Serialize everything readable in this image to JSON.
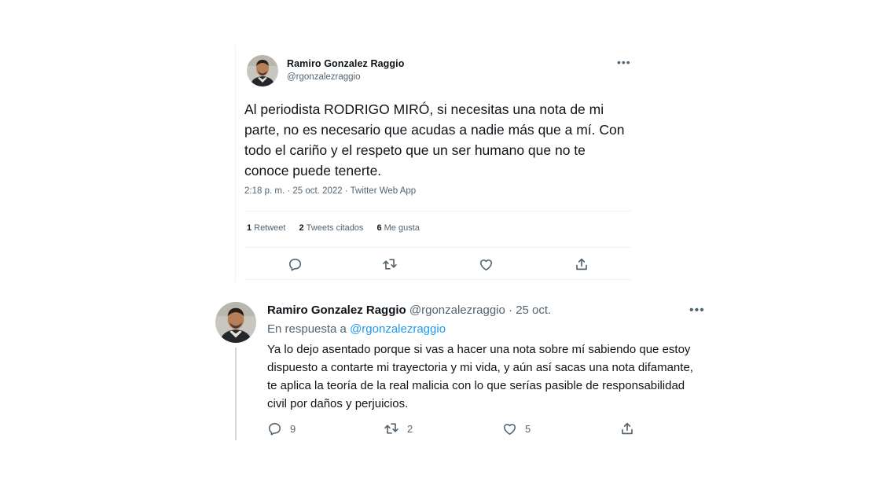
{
  "tweet1": {
    "author_name": "Ramiro Gonzalez Raggio",
    "author_handle": "@rgonzalezraggio",
    "more_icon": "more-horizontal-icon",
    "text": "Al periodista RODRIGO MIRÓ, si necesitas una nota de mi parte, no es necesario que acudas a nadie más que a mí. Con todo el cariño y el respeto que un ser humano que no te conoce puede tenerte.",
    "meta": "2:18 p. m. · 25 oct. 2022 · Twitter Web App",
    "stats": {
      "retweets_count": "1",
      "retweets_label": "Retweet",
      "quotes_count": "2",
      "quotes_label": "Tweets citados",
      "likes_count": "6",
      "likes_label": "Me gusta"
    },
    "actions": [
      "reply-icon",
      "retweet-icon",
      "like-icon",
      "share-icon"
    ]
  },
  "tweet2": {
    "author_name": "Ramiro Gonzalez Raggio",
    "author_handle": "@rgonzalezraggio",
    "separator": "·",
    "date": "25 oct.",
    "more_icon": "more-horizontal-icon",
    "reply_prefix": "En respuesta a",
    "reply_mention": "@rgonzalezraggio",
    "text": "Ya lo dejo asentado porque si vas a hacer una nota sobre mí sabiendo que estoy dispuesto a contarte mi trayectoria y mi vida, y aún así sacas una nota difamante, te aplica la teoría de la real malicia con lo que serías pasible de responsabilidad civil por daños y perjuicios.",
    "reply_count": "9",
    "retweet_count": "2",
    "like_count": "5"
  },
  "colors": {
    "text_primary": "#0f1419",
    "text_secondary": "#536471",
    "link_blue": "#1d9bf0",
    "divider": "#eff3f4",
    "thread_line": "#cfd9de"
  }
}
